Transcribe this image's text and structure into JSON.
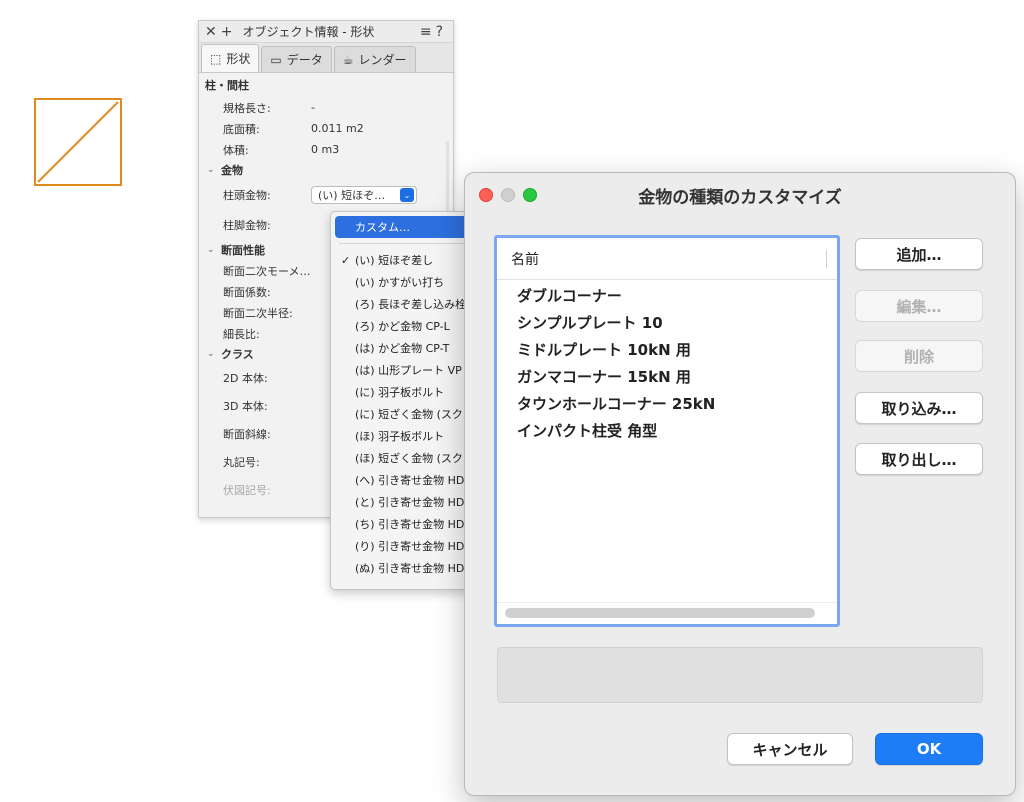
{
  "colors": {
    "accent": "#1f7cf7",
    "shape_stroke": "#e08a1e",
    "highlight": "#2d6fde"
  },
  "palette": {
    "title": "オブジェクト情報 - 形状",
    "close_icon": "close-icon",
    "add_icon": "plus-icon",
    "menu_icon": "≡",
    "help_icon": "?",
    "tabs": [
      {
        "label": "形状",
        "icon": "shape-icon"
      },
      {
        "label": "データ",
        "icon": "data-icon"
      },
      {
        "label": "レンダー",
        "icon": "render-icon"
      }
    ],
    "section_title": "柱・間柱",
    "rows_top": [
      {
        "label": "規格長さ:",
        "value": "-"
      },
      {
        "label": "底面積:",
        "value": "0.011 m2"
      },
      {
        "label": "体積:",
        "value": "0 m3"
      }
    ],
    "group_hardware": "金物",
    "hardware_top_label": "柱頭金物:",
    "hardware_top_value": "(い) 短ほぞ…",
    "hardware_bottom_label": "柱脚金物:",
    "group_section": "断面性能",
    "section_rows": [
      "断面二次モーメ…",
      "断面係数:",
      "断面二次半径:",
      "細長比:"
    ],
    "group_class": "クラス",
    "class_rows": [
      "2D 本体:",
      "3D 本体:",
      "断面斜線:",
      "丸記号:",
      "伏図記号:"
    ]
  },
  "dropdown": {
    "custom_item": "カスタム…",
    "items": [
      "(い) 短ほぞ差し",
      "(い) かすがい打ち",
      "(ろ) 長ほぞ差し込み栓",
      "(ろ) かど金物 CP-L",
      "(は) かど金物 CP-T",
      "(は) 山形プレート VP",
      "(に) 羽子板ボルト",
      "(に) 短ざく金物 (スク",
      "(ほ) 羽子板ボルト",
      "(ほ) 短ざく金物 (スク",
      "(へ) 引き寄せ金物 HD",
      "(と) 引き寄せ金物 HD",
      "(ち) 引き寄せ金物 HD",
      "(り) 引き寄せ金物 HD",
      "(ぬ) 引き寄せ金物 HD"
    ],
    "checked_index": 0
  },
  "dialog": {
    "title": "金物の種類のカスタマイズ",
    "list_header": "名前",
    "items": [
      "ダブルコーナー",
      "シンプルプレート 10",
      "ミドルプレート 10kN 用",
      "ガンマコーナー 15kN 用",
      "タウンホールコーナー 25kN",
      "インパクト柱受 角型"
    ],
    "buttons": {
      "add": "追加…",
      "edit": "編集…",
      "delete": "削除",
      "import": "取り込み…",
      "export": "取り出し…",
      "cancel": "キャンセル",
      "ok": "OK"
    }
  }
}
